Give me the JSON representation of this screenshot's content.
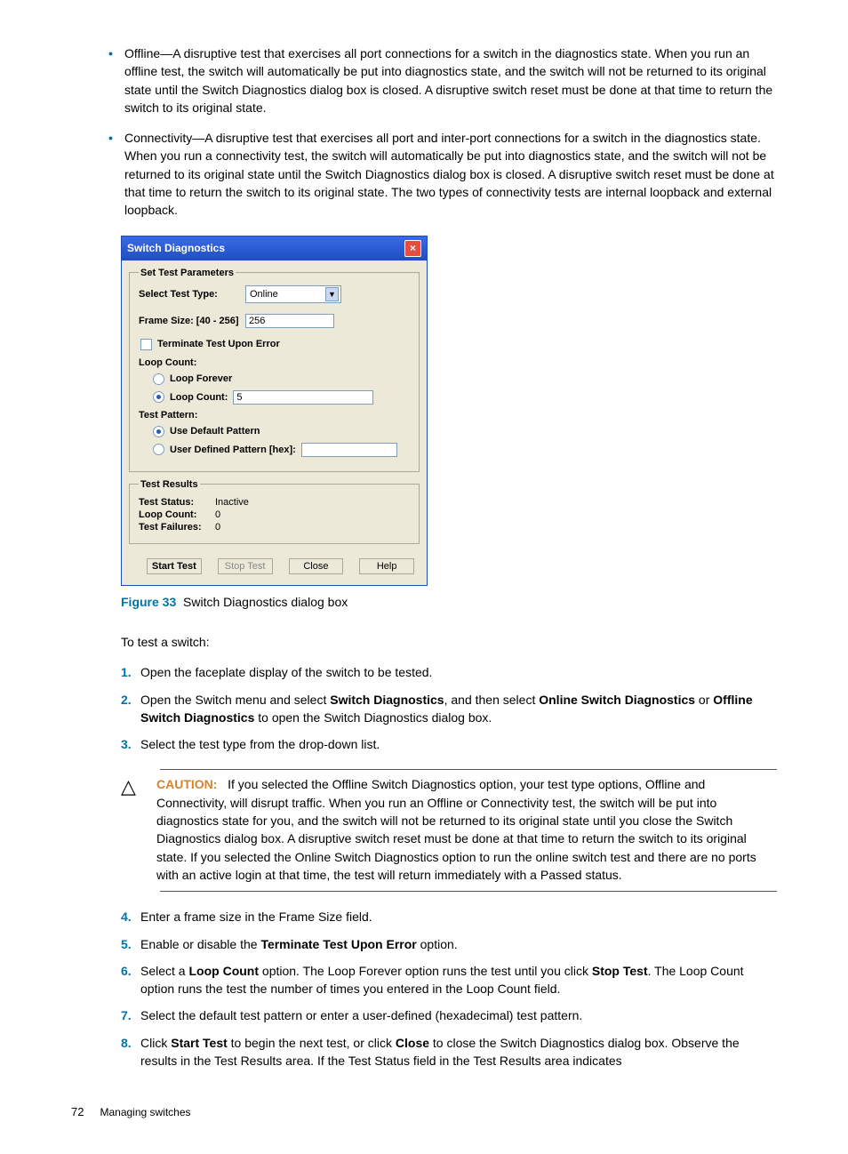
{
  "bullets": {
    "offline": "Offline—A disruptive test that exercises all port connections for a switch in the diagnostics state. When you run an offline test, the switch will automatically be put into diagnostics state, and the switch will not be returned to its original state until the Switch Diagnostics dialog box is closed. A disruptive switch reset must be done at that time to return the switch to its original state.",
    "connectivity": "Connectivity—A disruptive test that exercises all port and inter-port connections for a switch in the diagnostics state. When you run a connectivity test, the switch will automatically be put into diagnostics state, and the switch will not be returned to its original state until the Switch Diagnostics dialog box is closed. A disruptive switch reset must be done at that time to return the switch to its original state. The two types of connectivity tests are internal loopback and external loopback."
  },
  "dialog": {
    "title": "Switch Diagnostics",
    "set_params_legend": "Set Test Parameters",
    "select_test_type_label": "Select Test Type:",
    "select_test_type_value": "Online",
    "frame_size_label": "Frame Size: [40 - 256]",
    "frame_size_value": "256",
    "terminate_label": "Terminate Test Upon Error",
    "loop_count_group": "Loop Count:",
    "loop_forever_label": "Loop Forever",
    "loop_count_label": "Loop Count:",
    "loop_count_value": "5",
    "test_pattern_group": "Test Pattern:",
    "use_default_label": "Use Default Pattern",
    "user_defined_label": "User Defined Pattern [hex]:",
    "test_results_legend": "Test Results",
    "test_status_label": "Test Status:",
    "test_status_value": "Inactive",
    "loop_count_res_label": "Loop Count:",
    "loop_count_res_value": "0",
    "test_failures_label": "Test Failures:",
    "test_failures_value": "0",
    "buttons": {
      "start": "Start Test",
      "stop": "Stop Test",
      "close": "Close",
      "help": "Help"
    }
  },
  "figure": {
    "num": "Figure 33",
    "caption": "Switch Diagnostics dialog box"
  },
  "para_intro": "To test a switch:",
  "steps_a": {
    "1": "Open the faceplate display of the switch to be tested.",
    "2_pre": "Open the Switch menu and select ",
    "2_b1": "Switch Diagnostics",
    "2_mid": ", and then select ",
    "2_b2": "Online Switch Diagnostics",
    "2_or": " or ",
    "2_b3": "Offline Switch Diagnostics",
    "2_post": " to open the Switch Diagnostics dialog box.",
    "3": "Select the test type from the drop-down list."
  },
  "caution": {
    "label": "CAUTION:",
    "text": "If you selected the Offline Switch Diagnostics option, your test type options, Offline and Connectivity, will disrupt traffic. When you run an Offline or Connectivity test, the switch will be put into diagnostics state for you, and the switch will not be returned to its original state until you close the Switch Diagnostics dialog box. A disruptive switch reset must be done at that time to return the switch to its original state. If you selected the Online Switch Diagnostics option to run the online switch test and there are no ports with an active login at that time, the test will return immediately with a Passed status."
  },
  "steps_b": {
    "4": "Enter a frame size in the Frame Size field.",
    "5_pre": "Enable or disable the ",
    "5_b": "Terminate Test Upon Error",
    "5_post": " option.",
    "6_pre": "Select a ",
    "6_b1": "Loop Count",
    "6_mid": " option. The Loop Forever option runs the test until you click ",
    "6_b2": "Stop Test",
    "6_post": ". The Loop Count option runs the test the number of times you entered in the Loop Count field.",
    "7": "Select the default test pattern or enter a user-defined (hexadecimal) test pattern.",
    "8_pre": "Click ",
    "8_b1": "Start Test",
    "8_mid": " to begin the next test, or click ",
    "8_b2": "Close",
    "8_post": " to close the Switch Diagnostics dialog box. Observe the results in the Test Results area. If the Test Status field in the Test Results area indicates"
  },
  "footer": {
    "pagenum": "72",
    "section": "Managing switches"
  }
}
